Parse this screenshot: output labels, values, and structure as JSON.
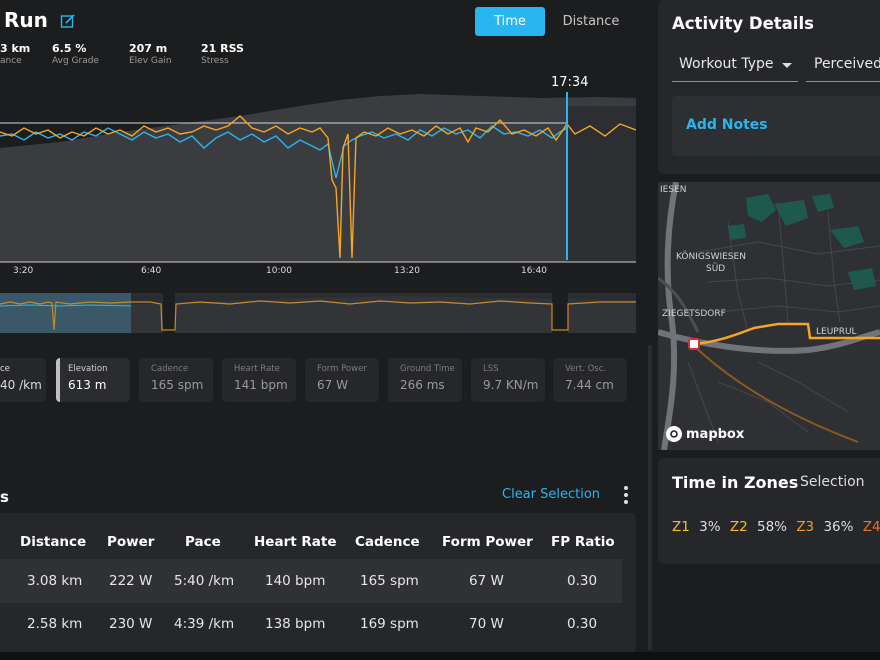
{
  "header": {
    "title": "Run",
    "time_label": "Time",
    "distance_label": "Distance"
  },
  "stats": [
    {
      "value": "3 km",
      "label": "ance"
    },
    {
      "value": "6.5 %",
      "label": "Avg Grade"
    },
    {
      "value": "207 m",
      "label": "Elev Gain"
    },
    {
      "value": "21 RSS",
      "label": "Stress"
    }
  ],
  "chart": {
    "cursor_time": "17:34",
    "x_ticks": [
      "3:20",
      "6:40",
      "10:00",
      "13:20",
      "16:40"
    ],
    "colors": {
      "power": "#f5a623",
      "pace": "#29b6f0",
      "elevation": "#4a4b4e"
    }
  },
  "metric_tiles": [
    {
      "label": "ce",
      "value": "40 /km"
    },
    {
      "label": "Elevation",
      "value": "613 m"
    },
    {
      "label": "Cadence",
      "value": "165 spm"
    },
    {
      "label": "Heart Rate",
      "value": "141 bpm"
    },
    {
      "label": "Form Power",
      "value": "67 W"
    },
    {
      "label": "Ground Time",
      "value": "266 ms"
    },
    {
      "label": "LSS",
      "value": "9.7 KN/m"
    },
    {
      "label": "Vert. Osc.",
      "value": "7.44 cm"
    }
  ],
  "laps": {
    "title": "s",
    "clear_selection": "Clear Selection",
    "headers": [
      "Distance",
      "Power",
      "Pace",
      "Heart Rate",
      "Cadence",
      "Form Power",
      "FP Ratio"
    ],
    "rows": [
      [
        "3.08 km",
        "222 W",
        "5:40 /km",
        "140 bpm",
        "165 spm",
        "67 W",
        "0.30"
      ],
      [
        "2.58 km",
        "230 W",
        "4:39 /km",
        "138 bpm",
        "169 spm",
        "70 W",
        "0.30"
      ]
    ]
  },
  "details": {
    "title": "Activity Details",
    "workout_type": "Workout Type",
    "perceived": "Perceived",
    "add_notes": "Add Notes"
  },
  "map": {
    "labels": [
      "IESEN",
      "KÖNIGSWIESEN",
      "SÜD",
      "ZIEGETSDORF",
      "LEUPRUL"
    ],
    "attribution": "mapbox"
  },
  "zones": {
    "title": "Time in Zones",
    "selection": "Selection",
    "items": [
      {
        "zone": "Z1",
        "pct": "3%",
        "color": "#f2c12e"
      },
      {
        "zone": "Z2",
        "pct": "58%",
        "color": "#f5b82e"
      },
      {
        "zone": "Z3",
        "pct": "36%",
        "color": "#f39a2a"
      },
      {
        "zone": "Z4",
        "pct": "",
        "color": "#e8742a"
      }
    ]
  }
}
